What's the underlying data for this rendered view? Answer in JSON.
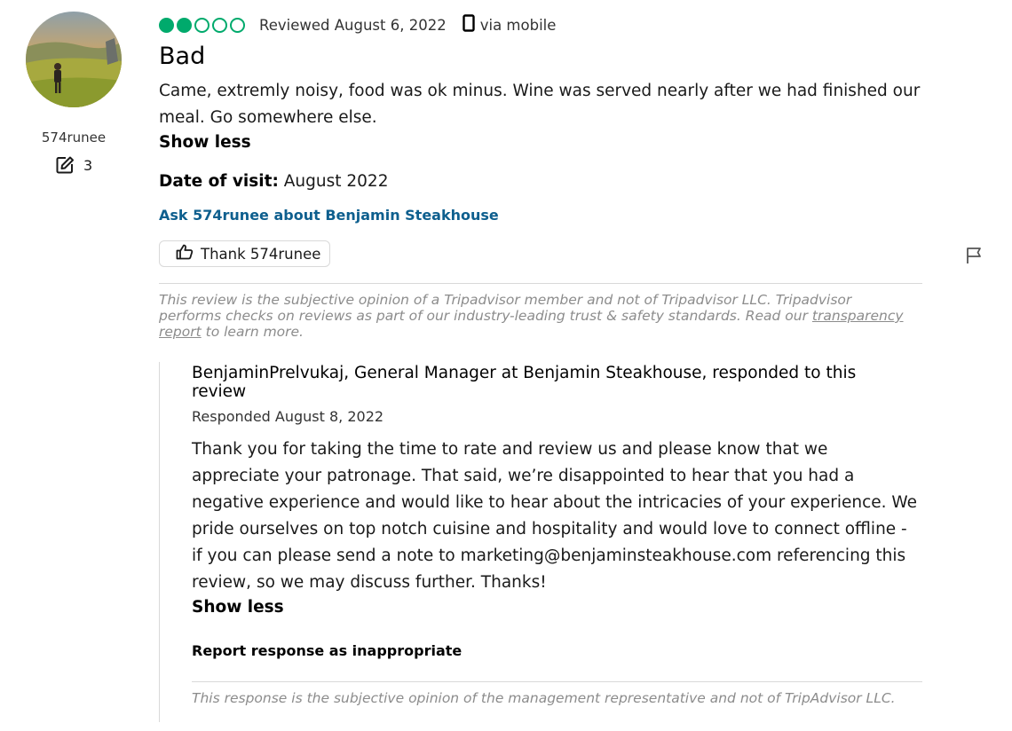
{
  "reviewer": {
    "username": "574runee",
    "contributions": "3"
  },
  "review": {
    "rating": 2,
    "rating_max": 5,
    "reviewed_date": "Reviewed August 6, 2022",
    "device": "via mobile",
    "title": "Bad",
    "body": "Came, extremly noisy, food was ok minus. Wine was served nearly after we had finished our meal. Go somewhere else.",
    "show_less": "Show less",
    "visit_label": "Date of visit:",
    "visit_value": "August 2022",
    "ask_link": "Ask 574runee about Benjamin Steakhouse",
    "thank_label": "Thank 574runee"
  },
  "disclaimer": {
    "text_before": "This review is the subjective opinion of a Tripadvisor member and not of Tripadvisor LLC. Tripadvisor performs checks on reviews as part of our industry-leading trust & safety standards. Read our ",
    "link": "transparency report",
    "text_after": " to learn more."
  },
  "response": {
    "header": "BenjaminPrelvukaj, General Manager at Benjamin Steakhouse, responded to this review",
    "date": "Responded August 8, 2022",
    "body": "Thank you for taking the time to rate and review us and please know that we appreciate your patronage. That said, we’re disappointed to hear that you had a negative experience and would like to hear about the intricacies of your experience. We pride ourselves on top notch cuisine and hospitality and would love to connect offline - if you can please send a note to marketing@benjaminsteakhouse.com referencing this review, so we may discuss further. Thanks!",
    "show_less": "Show less",
    "report": "Report response as inappropriate",
    "disclaimer": "This response is the subjective opinion of the management representative and not of TripAdvisor LLC."
  },
  "icons": {
    "avatar": "avatar-photo",
    "contributions": "edit-icon",
    "device": "mobile-phone-icon",
    "thank": "thumbs-up-icon",
    "flag": "flag-icon"
  },
  "colors": {
    "bubble": "#00aa6c",
    "link": "#0e5f8e"
  }
}
